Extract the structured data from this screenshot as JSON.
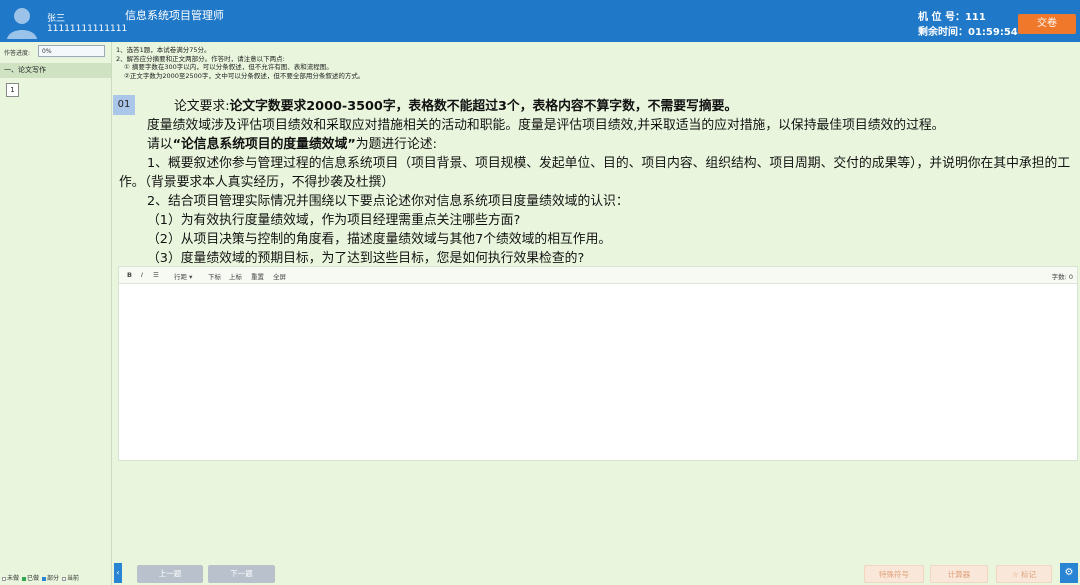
{
  "header": {
    "user_name": "张三",
    "user_id": "11111111111111",
    "exam_title": "信息系统项目管理师",
    "seat_label": "机 位 号：111",
    "timer_label": "剩余时间：01:59:54",
    "submit_label": "交卷"
  },
  "sidebar": {
    "progress_label": "作答进度:",
    "progress_text": "0%",
    "progress_fraction": 0,
    "section_title": "一、论文写作",
    "question_number": "1",
    "legend": [
      {
        "label": "未做",
        "color": "#ffffff"
      },
      {
        "label": "已做",
        "color": "#2fa84f"
      },
      {
        "label": "部分",
        "color": "#2a84d4"
      },
      {
        "label": "当前",
        "color": "#f7f7f7"
      }
    ]
  },
  "instructions": {
    "line1": "1、选答1题，本试卷满分75分。",
    "line2": "2、解答应分摘要和正文两部分。作答时，请注意以下两点:",
    "line3": "① 摘要字数在300字以内，可以分条叙述，但不允许有图、表和流程图。",
    "line4": "②正文字数为2000至2500字，文中可以分条叙述，但不要全部用分条叙述的方式。"
  },
  "question": {
    "number": "01",
    "req_prefix": "论文要求:",
    "req_bold": "论文字数要求2000-3500字，表格数不能超过3个，表格内容不算字数，不需要写摘要。",
    "intro": "度量绩效域涉及评估项目绩效和采取应对措施相关的活动和职能。度量是评估项目绩效,并采取适当的应对措施，以保持最佳项目绩效的过程。",
    "topic_prefix": "请以",
    "topic": "“论信息系统项目的度量绩效域”",
    "topic_suffix": "为题进行论述:",
    "point1": "1、概要叙述你参与管理过程的信息系统项目（项目背景、项目规模、发起单位、目的、项目内容、组织结构、项目周期、交付的成果等），并说明你在其中承担的工作。（背景要求本人真实经历，不得抄袭及杜撰）",
    "point2": "2、结合项目管理实际情况并围绕以下要点论述你对信息系统项目度量绩效域的认识：",
    "sub1": "（1）为有效执行度量绩效域，作为项目经理需重点关注哪些方面?",
    "sub2": "（2）从项目决策与控制的角度看，描述度量绩效域与其他7个绩效域的相互作用。",
    "sub3": "（3）度量绩效域的预期目标，为了达到这些目标，您是如何执行效果检查的?"
  },
  "editor": {
    "bold_label": "B",
    "italic_label": "I",
    "list_label": "☰",
    "line_spacing_label": "行距 ▾",
    "subscript_label": "下标",
    "superscript_label": "上标",
    "reset_label": "重置",
    "fullscreen_label": "全屏",
    "word_count_label": "字数: 0"
  },
  "footer": {
    "prev_label": "上一题",
    "next_label": "下一题",
    "special_symbol_label": "特殊符号",
    "calculator_label": "计算器",
    "mark_label": "☆ 标记",
    "collapse_icon": "‹",
    "settings_icon": "⚙"
  }
}
